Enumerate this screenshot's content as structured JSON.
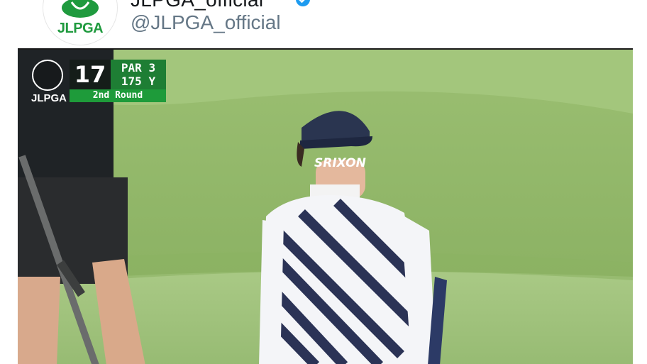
{
  "account": {
    "display_name": "JLPGA_official",
    "handle": "@JLPGA_official",
    "avatar_text": "JLPGA",
    "verified_color": "#1d9bf0"
  },
  "scorebug": {
    "logo_text": "JLPGA",
    "hole": "17",
    "par": "PAR 3",
    "yards": "175 Y",
    "round": "2nd Round",
    "green": "#1e7e34"
  },
  "video": {
    "cap_logo": "SRIXON"
  }
}
